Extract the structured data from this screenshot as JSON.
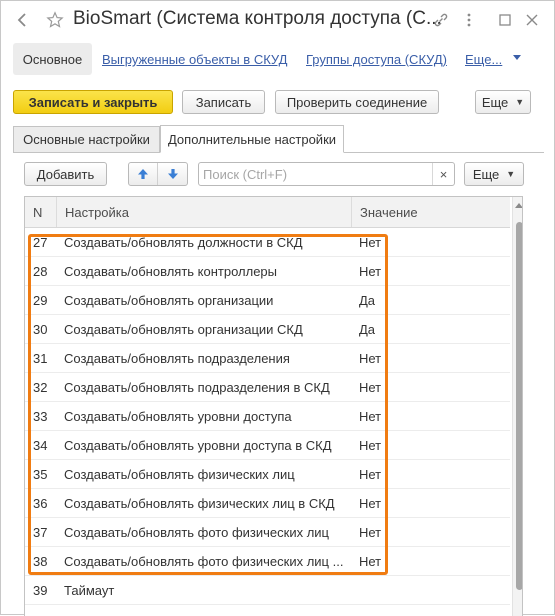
{
  "window": {
    "title": "BioSmart (Система контроля доступа (С...",
    "colors": {
      "accent_link": "#3a5ea8",
      "primary_button": "#f6d420",
      "highlight_border": "#f07c12"
    }
  },
  "nav": {
    "active": "Основное",
    "links": [
      "Выгруженные объекты в СКУД",
      "Группы доступа (СКУД)",
      "Еще..."
    ]
  },
  "toolbar": {
    "save_close": "Записать и закрыть",
    "save": "Записать",
    "check": "Проверить соединение",
    "more": "Еще"
  },
  "tabs": [
    "Основные настройки",
    "Дополнительные настройки"
  ],
  "table_toolbar": {
    "add": "Добавить",
    "search_placeholder": "Поиск (Ctrl+F)",
    "clear": "×",
    "more": "Еще",
    "up_icon": "arrow-up-icon",
    "down_icon": "arrow-down-icon"
  },
  "table": {
    "headers": [
      "N",
      "Настройка",
      "Значение"
    ],
    "rows": [
      {
        "n": "27",
        "name": "Создавать/обновлять должности в СКД",
        "value": "Нет"
      },
      {
        "n": "28",
        "name": "Создавать/обновлять контроллеры",
        "value": "Нет"
      },
      {
        "n": "29",
        "name": "Создавать/обновлять организации",
        "value": "Да"
      },
      {
        "n": "30",
        "name": "Создавать/обновлять организации СКД",
        "value": "Да"
      },
      {
        "n": "31",
        "name": "Создавать/обновлять подразделения",
        "value": "Нет"
      },
      {
        "n": "32",
        "name": "Создавать/обновлять подразделения в СКД",
        "value": "Нет"
      },
      {
        "n": "33",
        "name": "Создавать/обновлять уровни доступа",
        "value": "Нет"
      },
      {
        "n": "34",
        "name": "Создавать/обновлять уровни доступа в СКД",
        "value": "Нет"
      },
      {
        "n": "35",
        "name": "Создавать/обновлять физических лиц",
        "value": "Нет"
      },
      {
        "n": "36",
        "name": "Создавать/обновлять физических лиц в СКД",
        "value": "Нет"
      },
      {
        "n": "37",
        "name": "Создавать/обновлять фото физических лиц",
        "value": "Нет"
      },
      {
        "n": "38",
        "name": "Создавать/обновлять фото физических лиц ...",
        "value": "Нет"
      },
      {
        "n": "39",
        "name": "Таймаут",
        "value": ""
      }
    ]
  }
}
